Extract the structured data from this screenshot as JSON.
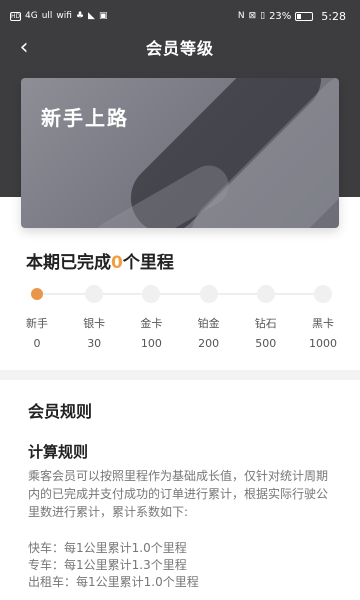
{
  "status_bar": {
    "left_glyphs": [
      "HD",
      "4G",
      "ull",
      "wifi",
      "♣",
      "◣",
      "▣"
    ],
    "right_glyphs": [
      "N",
      "⊠",
      "▯"
    ],
    "battery_percent": "23%",
    "battery_level": 0.23,
    "time": "5:28"
  },
  "header": {
    "back_icon": "‹",
    "title": "会员等级"
  },
  "card": {
    "title": "新手上路"
  },
  "progress": {
    "prefix": "本期已完成",
    "count": "0",
    "suffix": "个里程"
  },
  "levels": [
    {
      "name": "新手",
      "value": "0",
      "active": true
    },
    {
      "name": "银卡",
      "value": "30",
      "active": false
    },
    {
      "name": "金卡",
      "value": "100",
      "active": false
    },
    {
      "name": "铂金",
      "value": "200",
      "active": false
    },
    {
      "name": "钻石",
      "value": "500",
      "active": false
    },
    {
      "name": "黑卡",
      "value": "1000",
      "active": false
    }
  ],
  "rules": {
    "title": "会员规则",
    "calc_title": "计算规则",
    "body": "乘客会员可以按照里程作为基础成长值，仅针对统计周期内的已完成并支付成功的订单进行累计，根据实际行驶公里数进行累计，累计系数如下:",
    "coefficients": [
      "快车：每1公里累计1.0个里程",
      "专车：每1公里累计1.3个里程",
      "出租车：每1公里累计1.0个里程"
    ]
  },
  "colors": {
    "header_bg": "#3d3d40",
    "accent": "#e9964a",
    "highlight_text": "#f0a040"
  }
}
